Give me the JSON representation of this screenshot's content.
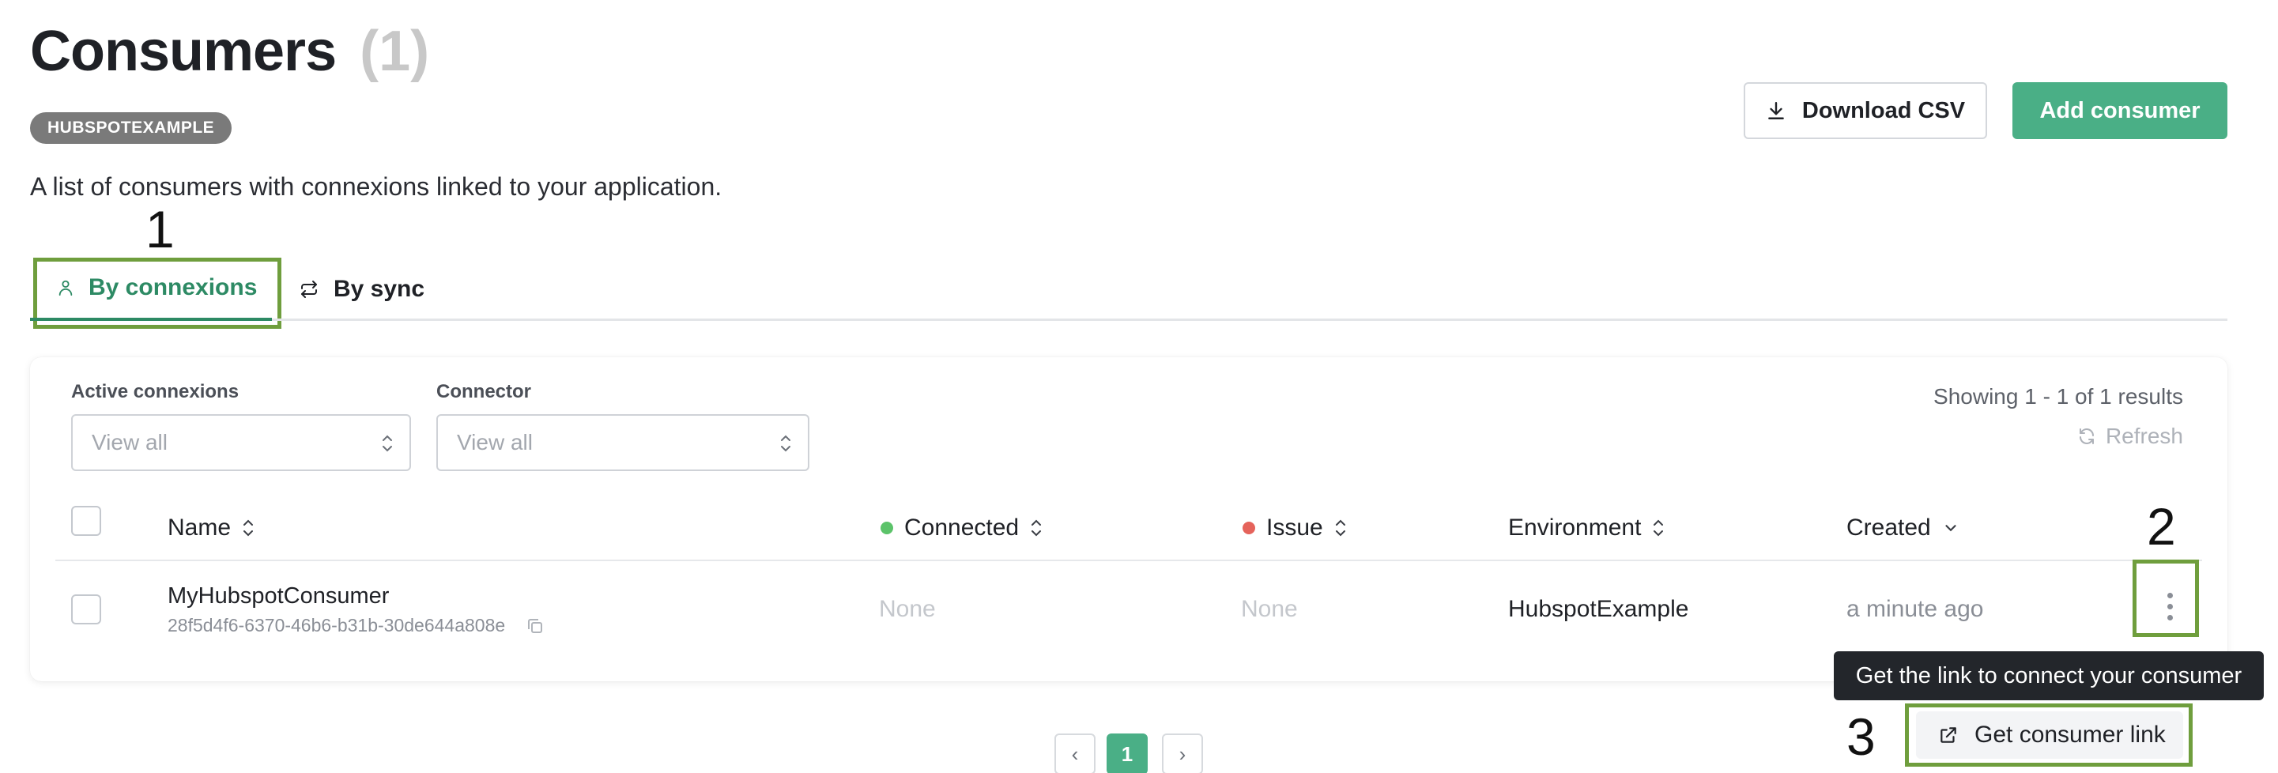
{
  "header": {
    "title": "Consumers",
    "count": "(1)",
    "environment_badge": "HUBSPOTEXAMPLE",
    "subtitle": "A list of consumers with connexions linked to your application.",
    "download_label": "Download CSV",
    "add_label": "Add consumer"
  },
  "annotations": {
    "one": "1",
    "two": "2",
    "three": "3",
    "box_color": "#6f9e3d"
  },
  "tabs": [
    {
      "label": "By connexions",
      "icon": "user-icon",
      "active": true
    },
    {
      "label": "By sync",
      "icon": "sync-icon",
      "active": false
    }
  ],
  "filters": {
    "active_connexions": {
      "label": "Active connexions",
      "placeholder": "View all"
    },
    "connector": {
      "label": "Connector",
      "placeholder": "View all"
    }
  },
  "results": {
    "showing": "Showing 1 - 1 of 1 results",
    "refresh": "Refresh"
  },
  "table": {
    "columns": {
      "name": "Name",
      "connected": "Connected",
      "issue": "Issue",
      "environment": "Environment",
      "created": "Created"
    },
    "rows": [
      {
        "name": "MyHubspotConsumer",
        "id": "28f5d4f6-6370-46b6-b31b-30de644a808e",
        "connected": "None",
        "issue": "None",
        "environment": "HubspotExample",
        "created": "a minute ago"
      }
    ]
  },
  "tooltip": "Get the link to connect your consumer",
  "menu": {
    "get_link": "Get consumer link"
  },
  "pagination": {
    "current": "1",
    "prev": "‹",
    "next": "›"
  },
  "colors": {
    "brand": "#4aaf86",
    "tab_active": "#2d8a64",
    "connected_dot": "#5cc36a",
    "issue_dot": "#e5635b"
  }
}
